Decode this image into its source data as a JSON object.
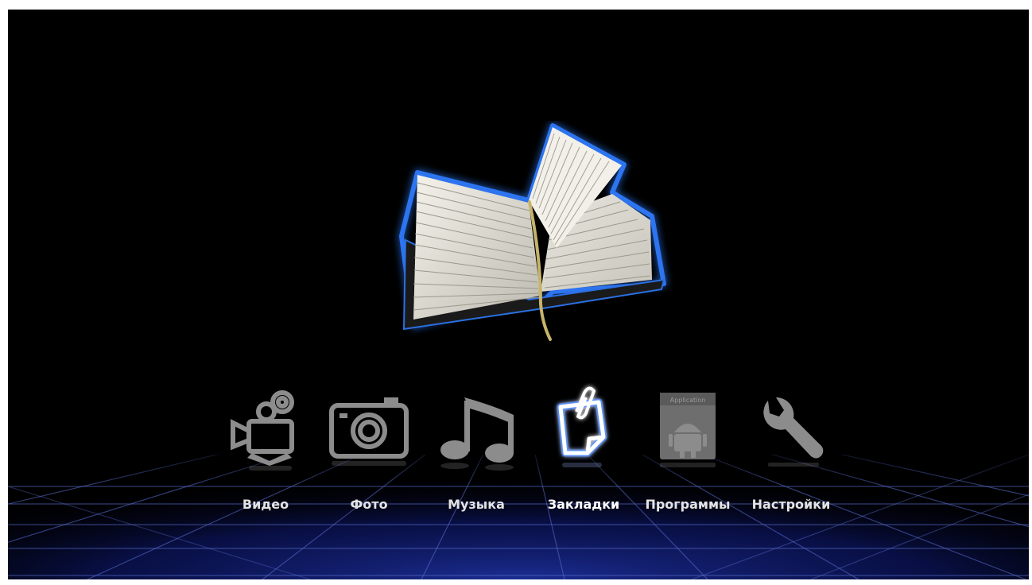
{
  "screen": {
    "hero_icon": "open-book-icon",
    "accent_color": "#3a8cff",
    "background_color": "#000000",
    "floor_color": "#1a2a8a"
  },
  "menu": {
    "selected_index": 3,
    "items": [
      {
        "label": "Видео",
        "icon": "video-camera-icon"
      },
      {
        "label": "Фото",
        "icon": "photo-camera-icon"
      },
      {
        "label": "Музыка",
        "icon": "music-note-icon"
      },
      {
        "label": "Закладки",
        "icon": "bookmark-clip-icon"
      },
      {
        "label": "Программы",
        "icon": "application-android-icon",
        "badge": "Application"
      },
      {
        "label": "Настройки",
        "icon": "wrench-icon"
      }
    ]
  }
}
